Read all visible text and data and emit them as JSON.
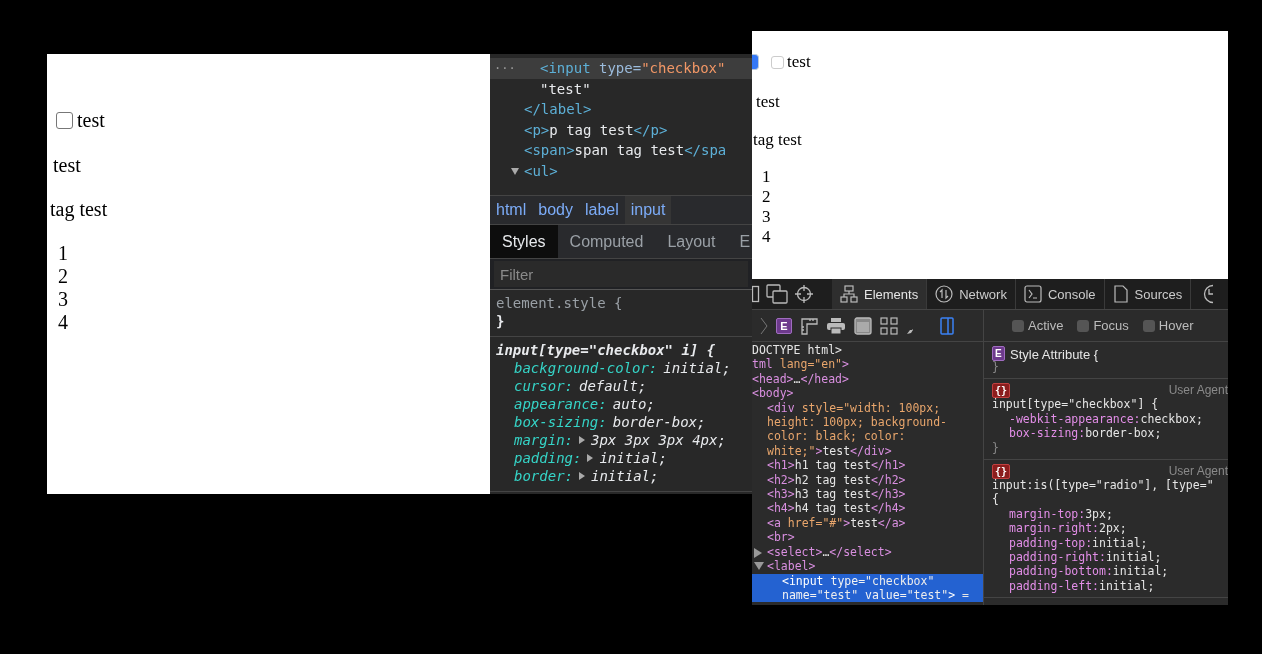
{
  "left_screenshot": {
    "page": {
      "checkbox": {
        "label": "test",
        "checked": false
      },
      "link": "test",
      "text": "tag test",
      "list_items": [
        "1",
        "2",
        "3",
        "4"
      ]
    },
    "devtools": {
      "dom_tree": [
        {
          "children": [
            {
              "marker": "...",
              "selected": true,
              "tokens": [
                {
                  "kind": "tag",
                  "text": "<input"
                },
                {
                  "kind": "attr",
                  "text": " type="
                },
                {
                  "kind": "val",
                  "text": "\"checkbox\""
                }
              ]
            },
            {
              "selected": false,
              "tokens": [
                {
                  "kind": "text",
                  "text": "\"test\""
                }
              ]
            }
          ]
        },
        {
          "selected": false,
          "tokens": [
            {
              "kind": "tag",
              "text": "</label>"
            }
          ]
        },
        {
          "selected": false,
          "tokens": [
            {
              "kind": "tag",
              "text": "<p>"
            },
            {
              "kind": "text",
              "text": "p tag test"
            },
            {
              "kind": "tag",
              "text": "</p>"
            }
          ]
        },
        {
          "selected": false,
          "tokens": [
            {
              "kind": "tag",
              "text": "<span>"
            },
            {
              "kind": "text",
              "text": "span tag test"
            },
            {
              "kind": "tag",
              "text": "</spa"
            }
          ]
        },
        {
          "selected": false,
          "expanded": true,
          "tokens": [
            {
              "kind": "tag",
              "text": "<ul>"
            }
          ]
        }
      ],
      "breadcrumbs": [
        {
          "label": "html",
          "selected": false
        },
        {
          "label": "body",
          "selected": false
        },
        {
          "label": "label",
          "selected": false
        },
        {
          "label": "input",
          "selected": true
        }
      ],
      "tabs": [
        {
          "label": "Styles",
          "selected": true
        },
        {
          "label": "Computed",
          "selected": false
        },
        {
          "label": "Layout",
          "selected": false
        },
        {
          "label": "E",
          "selected": false
        }
      ],
      "filter": {
        "placeholder": "Filter"
      },
      "rules": [
        {
          "selector": "element.style {",
          "user_agent": false,
          "closing": "}"
        },
        {
          "selector": "input[type=\"checkbox\" i] {",
          "user_agent": true,
          "declarations": [
            {
              "property": "background-color:",
              "value": "initial;",
              "expandable": false
            },
            {
              "property": "cursor:",
              "value": "default;",
              "expandable": false
            },
            {
              "property": "appearance:",
              "value": "auto;",
              "expandable": false
            },
            {
              "property": "box-sizing:",
              "value": "border-box;",
              "expandable": false
            },
            {
              "property": "margin:",
              "value": "3px 3px 3px 4px;",
              "expandable": true
            },
            {
              "property": "padding:",
              "value": "initial;",
              "expandable": true
            },
            {
              "property": "border:",
              "value": "initial;",
              "expandable": true
            }
          ]
        }
      ]
    }
  },
  "right_screenshot": {
    "page": {
      "checkbox": {
        "label": "test",
        "checked": false
      },
      "link": "test",
      "text": "tag test",
      "list_items": [
        "1",
        "2",
        "3",
        "4"
      ]
    },
    "devtools": {
      "tabs": [
        {
          "label": "Elements",
          "selected": true
        },
        {
          "label": "Network",
          "selected": false
        },
        {
          "label": "Console",
          "selected": false
        },
        {
          "label": "Sources",
          "selected": false
        }
      ],
      "element_badge": "E",
      "pseudo_classes": [
        {
          "label": "Active",
          "checked": false
        },
        {
          "label": "Focus",
          "checked": false
        },
        {
          "label": "Hover",
          "checked": false
        }
      ],
      "dom_tree": [
        {
          "selected": false,
          "tokens": [
            {
              "kind": "doctype",
              "text": "DOCTYPE html>"
            }
          ]
        },
        {
          "selected": false,
          "tokens": [
            {
              "kind": "tag",
              "text": "tml"
            },
            {
              "kind": "attr",
              "text": " lang="
            },
            {
              "kind": "val",
              "text": "\"en\""
            },
            {
              "kind": "tag",
              "text": ">"
            }
          ],
          "children": [
            {
              "selected": false,
              "tokens": [
                {
                  "kind": "tag",
                  "text": "<head>"
                },
                {
                  "kind": "text",
                  "text": "…"
                },
                {
                  "kind": "tag",
                  "text": "</head>"
                }
              ]
            },
            {
              "selected": false,
              "tokens": [
                {
                  "kind": "tag",
                  "text": "<body>"
                }
              ],
              "children": [
                {
                  "selected": false,
                  "tokens": [
                    {
                      "kind": "tag",
                      "text": "<div"
                    },
                    {
                      "kind": "attr",
                      "text": " style="
                    },
                    {
                      "kind": "val",
                      "text": "\"width: 100px; height: 100px; background-color: black; color: white;\""
                    },
                    {
                      "kind": "tag",
                      "text": ">"
                    },
                    {
                      "kind": "text",
                      "text": "test"
                    },
                    {
                      "kind": "tag",
                      "text": "</div>"
                    }
                  ]
                },
                {
                  "selected": false,
                  "tokens": [
                    {
                      "kind": "tag",
                      "text": "<h1>"
                    },
                    {
                      "kind": "text",
                      "text": "h1 tag test"
                    },
                    {
                      "kind": "tag",
                      "text": "</h1>"
                    }
                  ]
                },
                {
                  "selected": false,
                  "tokens": [
                    {
                      "kind": "tag",
                      "text": "<h2>"
                    },
                    {
                      "kind": "text",
                      "text": "h2 tag test"
                    },
                    {
                      "kind": "tag",
                      "text": "</h2>"
                    }
                  ]
                },
                {
                  "selected": false,
                  "tokens": [
                    {
                      "kind": "tag",
                      "text": "<h3>"
                    },
                    {
                      "kind": "text",
                      "text": "h3 tag test"
                    },
                    {
                      "kind": "tag",
                      "text": "</h3>"
                    }
                  ]
                },
                {
                  "selected": false,
                  "tokens": [
                    {
                      "kind": "tag",
                      "text": "<h4>"
                    },
                    {
                      "kind": "text",
                      "text": "h4 tag test"
                    },
                    {
                      "kind": "tag",
                      "text": "</h4>"
                    }
                  ]
                },
                {
                  "selected": false,
                  "tokens": [
                    {
                      "kind": "tag",
                      "text": "<a"
                    },
                    {
                      "kind": "attr",
                      "text": " href="
                    },
                    {
                      "kind": "val",
                      "text": "\"#\""
                    },
                    {
                      "kind": "tag",
                      "text": ">"
                    },
                    {
                      "kind": "text",
                      "text": "test"
                    },
                    {
                      "kind": "tag",
                      "text": "</a>"
                    }
                  ]
                },
                {
                  "selected": false,
                  "tokens": [
                    {
                      "kind": "tag",
                      "text": "<br>"
                    }
                  ]
                },
                {
                  "selected": false,
                  "expanded": false,
                  "tokens": [
                    {
                      "kind": "tag",
                      "text": "<select>"
                    },
                    {
                      "kind": "text",
                      "text": "…"
                    },
                    {
                      "kind": "tag",
                      "text": "</select>"
                    }
                  ]
                },
                {
                  "selected": false,
                  "expanded": true,
                  "tokens": [
                    {
                      "kind": "tag",
                      "text": "<label>"
                    }
                  ],
                  "children": [
                    {
                      "selected": true,
                      "tokens": [
                        {
                          "kind": "tag",
                          "text": "<input"
                        },
                        {
                          "kind": "attr",
                          "text": " type="
                        },
                        {
                          "kind": "val",
                          "text": "\"checkbox\""
                        },
                        {
                          "kind": "attr",
                          "text": " name="
                        },
                        {
                          "kind": "val",
                          "text": "\"test\""
                        },
                        {
                          "kind": "attr",
                          "text": " value="
                        },
                        {
                          "kind": "val",
                          "text": "\"test\""
                        },
                        {
                          "kind": "tag",
                          "text": ">"
                        },
                        {
                          "kind": "text",
                          "text": " ="
                        }
                      ]
                    }
                  ]
                }
              ]
            }
          ]
        }
      ],
      "rules": [
        {
          "kind": "style_attribute",
          "badge": "E",
          "selector": "Style Attribute {",
          "closing": "}"
        },
        {
          "kind": "user_agent",
          "badge": "{}",
          "origin": "User Agent",
          "selector": "input[type=\"checkbox\"] {",
          "closing": "}",
          "declarations": [
            {
              "property": "-webkit-appearance:",
              "value": "checkbox;"
            },
            {
              "property": "box-sizing:",
              "value": "border-box;"
            }
          ]
        },
        {
          "kind": "user_agent",
          "badge": "{}",
          "origin": "User Agent",
          "selector": "input:is([type=\"radio\"], [type=\"",
          "selector_end": "{",
          "declarations": [
            {
              "property": "margin-top:",
              "value": "3px;"
            },
            {
              "property": "margin-right:",
              "value": "2px;"
            },
            {
              "property": "padding-top:",
              "value": "initial;"
            },
            {
              "property": "padding-right:",
              "value": "initial;"
            },
            {
              "property": "padding-bottom:",
              "value": "initial;"
            },
            {
              "property": "padding-left:",
              "value": "initial;"
            }
          ]
        }
      ]
    }
  }
}
